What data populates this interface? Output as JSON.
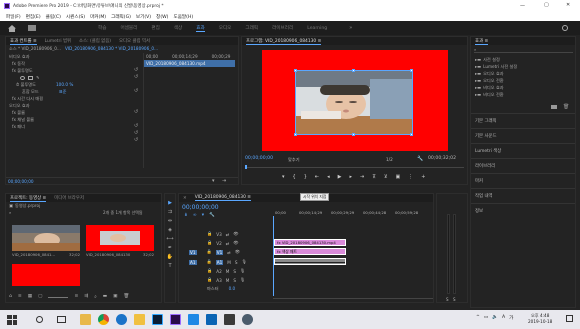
{
  "app": {
    "title": "Adobe Premiere Pro 2019 - C:\\바탕화면\\유튜브\\애니의 신발\\동영상.prproj *",
    "window_controls": [
      "—",
      "▢",
      "✕"
    ]
  },
  "menu": [
    "파일(F)",
    "편집(E)",
    "클립(C)",
    "시퀀스(S)",
    "마커(M)",
    "그래픽(G)",
    "보기(V)",
    "창(W)",
    "도움말(H)"
  ],
  "workspaces": [
    "학습",
    "어셈블리",
    "편집",
    "색상",
    "효과",
    "오디오",
    "그래픽",
    "라이브러리",
    "Learning"
  ],
  "active_workspace": "효과",
  "source_panel": {
    "tabs": [
      "효과 컨트롤 ≡",
      "Lumetri 범위",
      "소스: (클립 없음)",
      "오디오 클립 믹서"
    ],
    "source_label": "소스 * VID_20180906_0...",
    "clip_label": "VID_20180906_084130 * VID_20180906_0...",
    "section_video": "비디오 효과",
    "fx_motion": "fx 동작",
    "fx_opacity": "fx 불투명도",
    "opacity_value": "100.0 %",
    "blend_label": "혼합 모드",
    "blend_value": "표준",
    "fx_time": "fx 시간 다시 매핑",
    "section_audio": "오디오 효과",
    "fx_volume": "fx 볼륨",
    "fx_channel": "fx 채널 볼륨",
    "fx_panner": "fx 패너",
    "mini_tc_start": "00;00",
    "mini_tc_mid": "00;00;14;29",
    "mini_tc_end": "00;00;29",
    "mini_clip": "VID_20180906_084130.mp4",
    "timecode": "00;00;00;00"
  },
  "program": {
    "title": "프로그램: VID_20180906_084130 ≡",
    "timecode": "00;00;00;00",
    "fit": "맞추기",
    "scale": "1/2",
    "duration": "00;00;32;02",
    "colors": {
      "frame": "#ff0000",
      "selection": "#5aa7ff"
    }
  },
  "effects_panel": {
    "title": "효과 ≡",
    "folders": [
      "사전 설정",
      "Lumetri 사전 설정",
      "오디오 효과",
      "오디오 전환",
      "비디오 효과",
      "비디오 전환"
    ],
    "sections": [
      "기본 그래픽",
      "기본 사운드",
      "Lumetri 색상",
      "라이브러리",
      "마커",
      "작업 내역",
      "정보"
    ]
  },
  "project": {
    "tabs": [
      "프로젝트: 동영상 ≡",
      "미디어 브라우저"
    ],
    "file": "동영상.prproj",
    "count": "2개 중 1개 항목 선택됨",
    "items": [
      {
        "name": "VID_20180906_0841...",
        "duration": "32;02"
      },
      {
        "name": "VID_20180906_084130",
        "duration": "32;02"
      }
    ]
  },
  "timeline": {
    "title": "VID_20180906_084130 ≡",
    "timecode": "00;00;00;00",
    "ruler": [
      "00;00",
      "00;00;14;29",
      "00;00;29;29",
      "00;00;44;28",
      "00;00;59;28"
    ],
    "tooltip": "시작 위치 지점",
    "video_tracks": [
      "V3",
      "V2",
      "V1"
    ],
    "audio_tracks": [
      "A1",
      "A2",
      "A3"
    ],
    "source_patch": [
      "V1",
      "A1"
    ],
    "master": "마스터",
    "master_value": "0.0",
    "clip_video": "VID_20180906_084130.mp4",
    "clip_effect": "색상 매트",
    "clip_color": "#d98ad9",
    "audio_clip_color": "#8a8a8a"
  },
  "taskbar": {
    "time": "오후 4:48",
    "date": "2019-10-18",
    "lang": "A",
    "lang2": "가"
  }
}
